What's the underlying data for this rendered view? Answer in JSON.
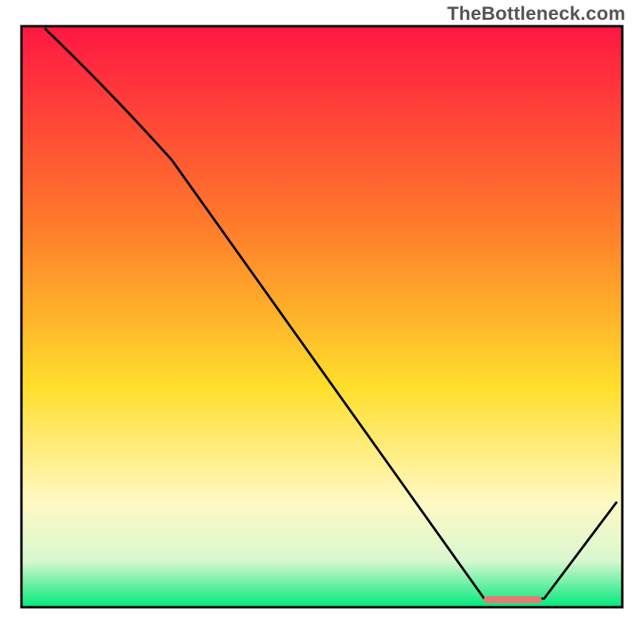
{
  "attribution": "TheBottleneck.com",
  "colors": {
    "gradient_top": "#ff1742",
    "gradient_mid_upper": "#ff7a2b",
    "gradient_mid": "#ffde2b",
    "gradient_mid_lower": "#fff9c4",
    "gradient_bottom_band": "#d9f7d0",
    "gradient_bottom": "#00e97a",
    "line": "#000000",
    "marker": "#e77a74",
    "frame": "#000000"
  },
  "chart_data": {
    "type": "line",
    "title": "",
    "xlabel": "",
    "ylabel": "",
    "xlim": [
      0,
      100
    ],
    "ylim": [
      0,
      100
    ],
    "grid": false,
    "legend": false,
    "series": [
      {
        "name": "curve",
        "points": [
          {
            "x": 4.0,
            "y": 99.5
          },
          {
            "x": 25.0,
            "y": 77.0
          },
          {
            "x": 77.0,
            "y": 1.5
          },
          {
            "x": 87.0,
            "y": 1.5
          },
          {
            "x": 99.0,
            "y": 18.0
          }
        ]
      }
    ],
    "annotations": [
      {
        "name": "highlight-segment",
        "type": "segment",
        "x0": 77.5,
        "x1": 86.0,
        "y": 1.3
      }
    ]
  }
}
